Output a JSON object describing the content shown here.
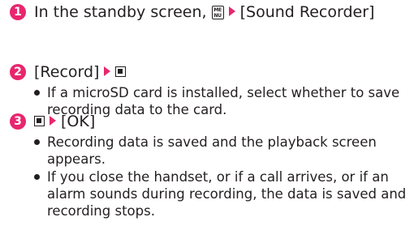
{
  "steps": [
    {
      "number": "1",
      "text_a": "In the standby screen, ",
      "key_icon": "menu-key-icon",
      "key_label_top": "ME",
      "key_label_bottom": "NU",
      "text_b": "[Sound Recorder]"
    },
    {
      "number": "2",
      "text_a": "[Record]",
      "key_icon": "stop-square-key-icon",
      "bullets": [
        "If a microSD card is installed, select whether to save recording data to the card."
      ]
    },
    {
      "number": "3",
      "key_icon": "stop-square-key-icon",
      "text_b": "[OK]",
      "bullets": [
        "Recording data is saved and the playback screen appears.",
        "If you close the handset, or if a call arrives, or if an alarm sounds during recording, the data is saved and recording stops."
      ]
    }
  ],
  "colors": {
    "accent": "#e8266e",
    "text": "#231f20"
  }
}
